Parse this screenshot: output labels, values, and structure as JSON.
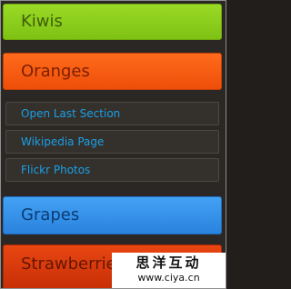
{
  "accordion": {
    "sections": [
      {
        "label": "Kiwis",
        "color": "#8bd01e"
      },
      {
        "label": "Oranges",
        "color": "#f45d12"
      },
      {
        "label": "Grapes",
        "color": "#3592ea"
      },
      {
        "label": "Strawberries",
        "color": "#d83a0b"
      }
    ],
    "links": [
      {
        "label": "Open Last Section",
        "color": "#1aa0e8"
      },
      {
        "label": "Wikipedia Page",
        "color": "#1aa0e8"
      },
      {
        "label": "Flickr Photos",
        "color": "#1aa0e8"
      }
    ]
  },
  "watermark": {
    "title": "思洋互动",
    "url": "www.ciya.cn"
  }
}
